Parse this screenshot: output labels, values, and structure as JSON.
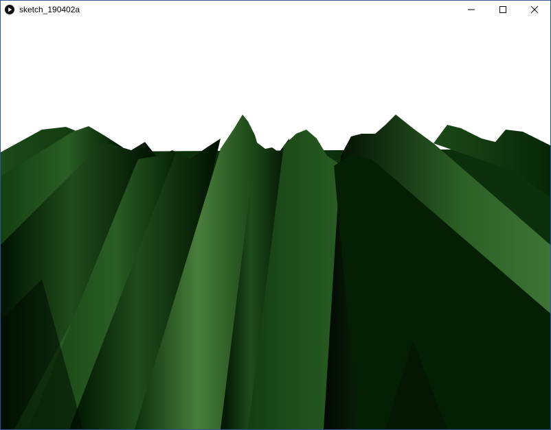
{
  "window": {
    "title": "sketch_190402a",
    "app_icon": "processing-play-icon",
    "controls": {
      "minimize": "minimize-icon",
      "maximize": "maximize-icon",
      "close": "close-icon"
    }
  },
  "canvas": {
    "background": "#ffffff",
    "terrain_color": "#2f6b28",
    "terrain_shadow": "#001600",
    "terrain_highlight": "#4a7e3c"
  }
}
